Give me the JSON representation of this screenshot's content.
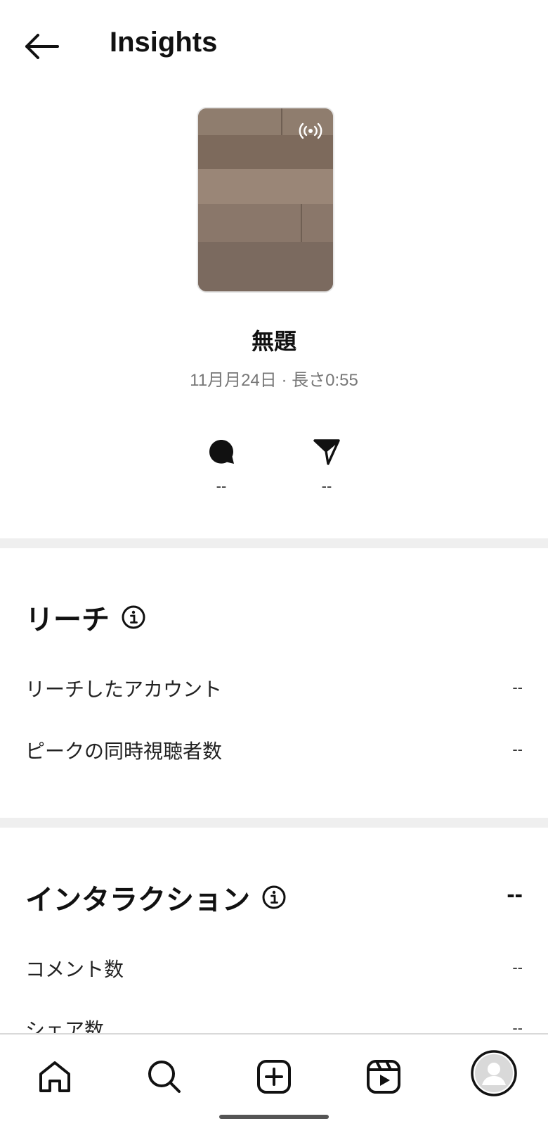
{
  "header": {
    "title": "Insights",
    "back_icon": "arrow-left-icon"
  },
  "post": {
    "title": "無題",
    "meta": "11月月24日 · 長さ0:55",
    "badge_icon": "live-broadcast-icon"
  },
  "engagement": {
    "comments": {
      "icon": "comment-icon",
      "value": "--"
    },
    "shares": {
      "icon": "send-icon",
      "value": "--"
    }
  },
  "reach": {
    "title": "リーチ",
    "info_icon": "info-icon",
    "rows": [
      {
        "label": "リーチしたアカウント",
        "value": "--"
      },
      {
        "label": "ピークの同時視聴者数",
        "value": "--"
      }
    ]
  },
  "interaction": {
    "title": "インタラクション",
    "info_icon": "info-icon",
    "total": "--",
    "rows": [
      {
        "label": "コメント数",
        "value": "--"
      },
      {
        "label": "シェア数",
        "value": "--"
      }
    ]
  },
  "bottom_nav": {
    "items": [
      {
        "name": "home",
        "icon": "home-icon"
      },
      {
        "name": "search",
        "icon": "search-icon"
      },
      {
        "name": "create",
        "icon": "plus-square-icon"
      },
      {
        "name": "reels",
        "icon": "reels-icon"
      },
      {
        "name": "profile",
        "icon": "avatar-icon"
      }
    ]
  },
  "colors": {
    "text": "#111111",
    "muted": "#777777",
    "divider": "#efefef"
  }
}
